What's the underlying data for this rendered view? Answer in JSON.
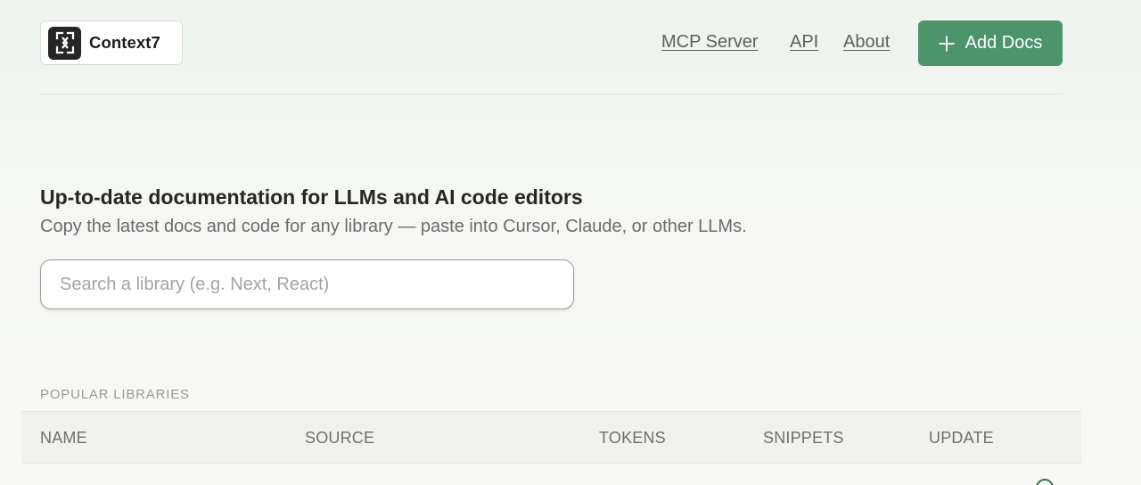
{
  "header": {
    "logo_text": "Context7",
    "nav": {
      "mcp_server": "MCP Server",
      "api": "API",
      "about": "About"
    },
    "add_docs_label": "Add Docs"
  },
  "hero": {
    "title": "Up-to-date documentation for LLMs and AI code editors",
    "subtitle": "Copy the latest docs and code for any library — paste into Cursor, Claude, or other LLMs.",
    "search_placeholder": "Search a library (e.g. Next, React)",
    "search_value": ""
  },
  "libraries": {
    "section_label": "POPULAR LIBRARIES",
    "columns": {
      "name": "NAME",
      "source": "SOURCE",
      "tokens": "TOKENS",
      "snippets": "SNIPPETS",
      "update": "UPDATE"
    }
  },
  "icons": {
    "logo": "context7-logo-icon",
    "add": "plus-icon",
    "status": "status-circle-icon"
  },
  "colors": {
    "accent": "#4c956b",
    "accent_text": "#3f8c5d"
  }
}
